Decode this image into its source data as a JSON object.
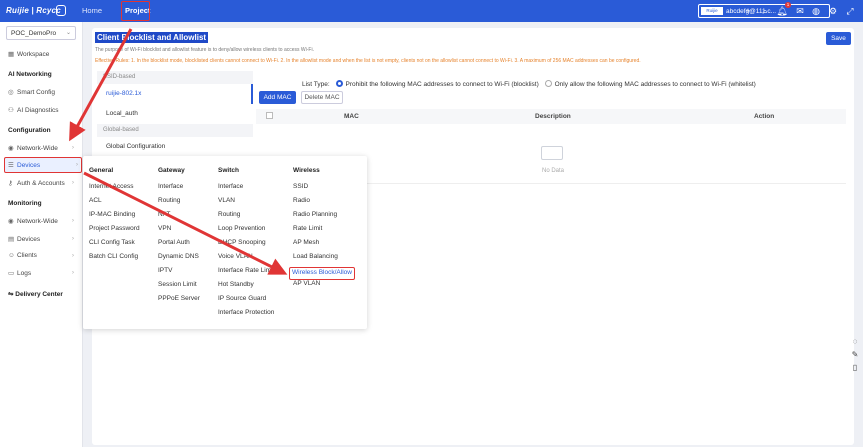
{
  "topbar": {
    "logo": "Ruijie | Rcycc",
    "nav": [
      "Home",
      "Project"
    ],
    "active_nav": "Project",
    "user_avatar_text": "Ruijie",
    "user": "abcdefg@111.c...",
    "notification_count": "1",
    "icons": [
      "plus-icon",
      "search-icon",
      "bell-icon",
      "mail-icon",
      "globe-icon",
      "settings-icon",
      "expand-icon"
    ]
  },
  "sidebar": {
    "project": "POC_DemoPro",
    "workspace": "Workspace",
    "ai_networking": "AI Networking",
    "smart_config": "Smart Config",
    "ai_diagnostics": "AI Diagnostics",
    "configuration": "Configuration",
    "network_wide": "Network-Wide",
    "devices": "Devices",
    "auth_accounts": "Auth & Accounts",
    "monitoring": "Monitoring",
    "mon_network_wide": "Network-Wide",
    "mon_devices": "Devices",
    "mon_clients": "Clients",
    "mon_logs": "Logs",
    "delivery_center": "Delivery Center"
  },
  "main": {
    "title": "Client Blocklist and Allowlist",
    "save": "Save",
    "description": "The purpose of Wi-Fi blocklist and allowlist feature is to deny/allow wireless clients to access Wi-Fi.",
    "rules": "Effective Rules: 1. In the blocklist mode, blocklisted clients cannot connect to Wi-Fi. 2. In the allowlist mode and when the list is not empty, clients not on the allowlist cannot connect to Wi-Fi. 3. A maximum of 256 MAC addresses can be configured.",
    "ssid_based": "SSID-based",
    "ssids": [
      "ruijie-802.1x",
      "Local_auth"
    ],
    "global_based": "Global-based",
    "global_config": "Global Configuration",
    "list_type_label": "List Type:",
    "option_blocklist": "Prohibit the following MAC addresses to connect to Wi-Fi (blocklist)",
    "option_allowlist": "Only allow the following MAC addresses to connect to Wi-Fi (whitelist)",
    "add_mac": "Add MAC",
    "delete_mac": "Delete MAC",
    "col_mac": "MAC",
    "col_description": "Description",
    "col_action": "Action",
    "no_data": "No Data"
  },
  "megamenu": {
    "general": {
      "title": "General",
      "items": [
        "Internet Access",
        "ACL",
        "IP-MAC Binding",
        "Project Password",
        "CLI Config Task",
        "Batch CLI Config"
      ]
    },
    "gateway": {
      "title": "Gateway",
      "items": [
        "Interface",
        "Routing",
        "NAT",
        "VPN",
        "Portal Auth",
        "Dynamic DNS",
        "IPTV",
        "Session Limit",
        "PPPoE Server"
      ]
    },
    "switch": {
      "title": "Switch",
      "items": [
        "Interface",
        "VLAN",
        "Routing",
        "Loop Prevention",
        "DHCP Snooping",
        "Voice VLAN",
        "Interface Rate Limit",
        "Hot Standby",
        "IP Source Guard",
        "Interface Protection"
      ]
    },
    "wireless": {
      "title": "Wireless",
      "items": [
        "SSID",
        "Radio",
        "Radio Planning",
        "Rate Limit",
        "AP Mesh",
        "Load Balancing",
        "Wireless Block/Allow",
        "AP VLAN"
      ]
    }
  },
  "accent_color": "#2a5bd7",
  "annotation_color": "#e03535"
}
